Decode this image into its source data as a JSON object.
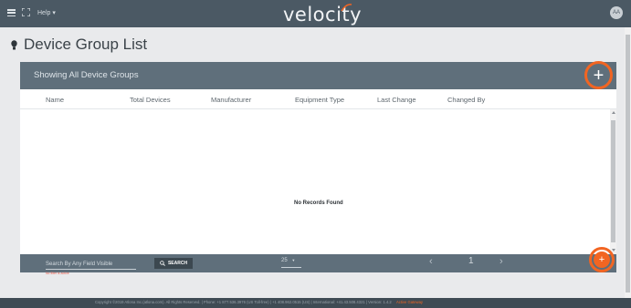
{
  "topbar": {
    "help_label": "Help ▾",
    "brand": "velocity",
    "avatar_initials": "AA"
  },
  "page": {
    "title": "Device Group List"
  },
  "card": {
    "header_title": "Showing All Device Groups",
    "add_label": "+",
    "columns": [
      "Name",
      "Total Devices",
      "Manufacturer",
      "Equipment Type",
      "Last Change",
      "Changed By"
    ],
    "empty_message": "No Records Found"
  },
  "footer": {
    "search_placeholder": "Search By Any Field Visible",
    "search_hint": "No filter is active",
    "search_button": "SEARCH",
    "page_size": "25",
    "current_page": "1",
    "fab_label": "+"
  },
  "copyright": {
    "text": "Copyright ©2019 Atlona Inc.(atlona.com). All Rights Reserved. | Phone: +1 877.536.3976 (US Toll-free) | +1 408.962.0515 (US) | International: +41.43.508.4321 | Version: 1.4.2",
    "gateway": "Active Gateway"
  },
  "colors": {
    "accent": "#f26522",
    "header": "#5f6f7b",
    "topbar": "#4b5964"
  }
}
